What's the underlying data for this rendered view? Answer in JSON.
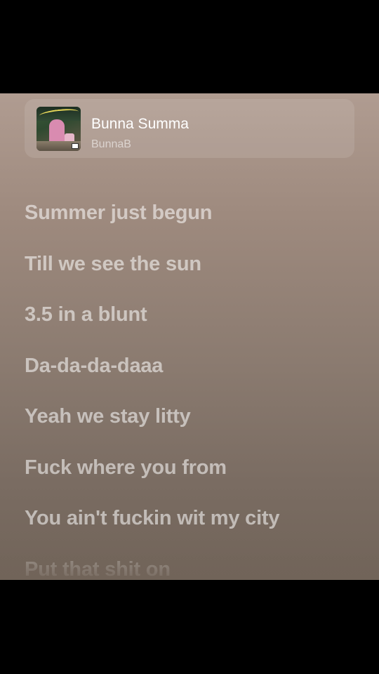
{
  "now_playing": {
    "title": "Bunna Summa",
    "artist": "BunnaB",
    "album_art_icon": "album-cover-image"
  },
  "lyrics": [
    "Summer just begun",
    "Till we see the sun",
    "3.5 in a blunt",
    "Da-da-da-daaa",
    "Yeah we stay litty",
    "Fuck where you from",
    "You ain't fuckin wit my city",
    "Put that shit on"
  ],
  "colors": {
    "background_top": "#b09c91",
    "background_bottom": "#716459",
    "letterbox": "#000000",
    "lyric_text": "#ffffff"
  }
}
